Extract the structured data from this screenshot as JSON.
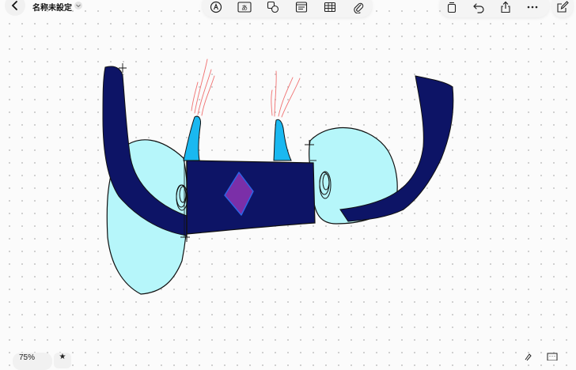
{
  "header": {
    "document_title": "名称未設定",
    "icons": {
      "back": "chevron-left-icon",
      "title_menu": "chevron-down-icon"
    }
  },
  "toolbar": {
    "tools": [
      {
        "name": "pen-tool-icon"
      },
      {
        "name": "text-box-icon",
        "glyph": "あ"
      },
      {
        "name": "shapes-icon"
      },
      {
        "name": "sticky-note-icon"
      },
      {
        "name": "table-icon"
      },
      {
        "name": "attachment-icon"
      }
    ],
    "right_tools": [
      {
        "name": "board-navigator-icon"
      },
      {
        "name": "undo-icon"
      },
      {
        "name": "share-icon"
      },
      {
        "name": "more-icon"
      }
    ],
    "new_board": {
      "name": "compose-icon"
    }
  },
  "footer": {
    "zoom_label": "75%",
    "star_glyph": "★"
  },
  "colors": {
    "navy": "#0d1466",
    "light_cyan": "#b6f6fa",
    "bright_cyan": "#1ab8f0",
    "purple": "#7b2fa8",
    "diamond_border": "#2c66e8",
    "red_stroke": "#f07070",
    "outline": "#111111"
  }
}
